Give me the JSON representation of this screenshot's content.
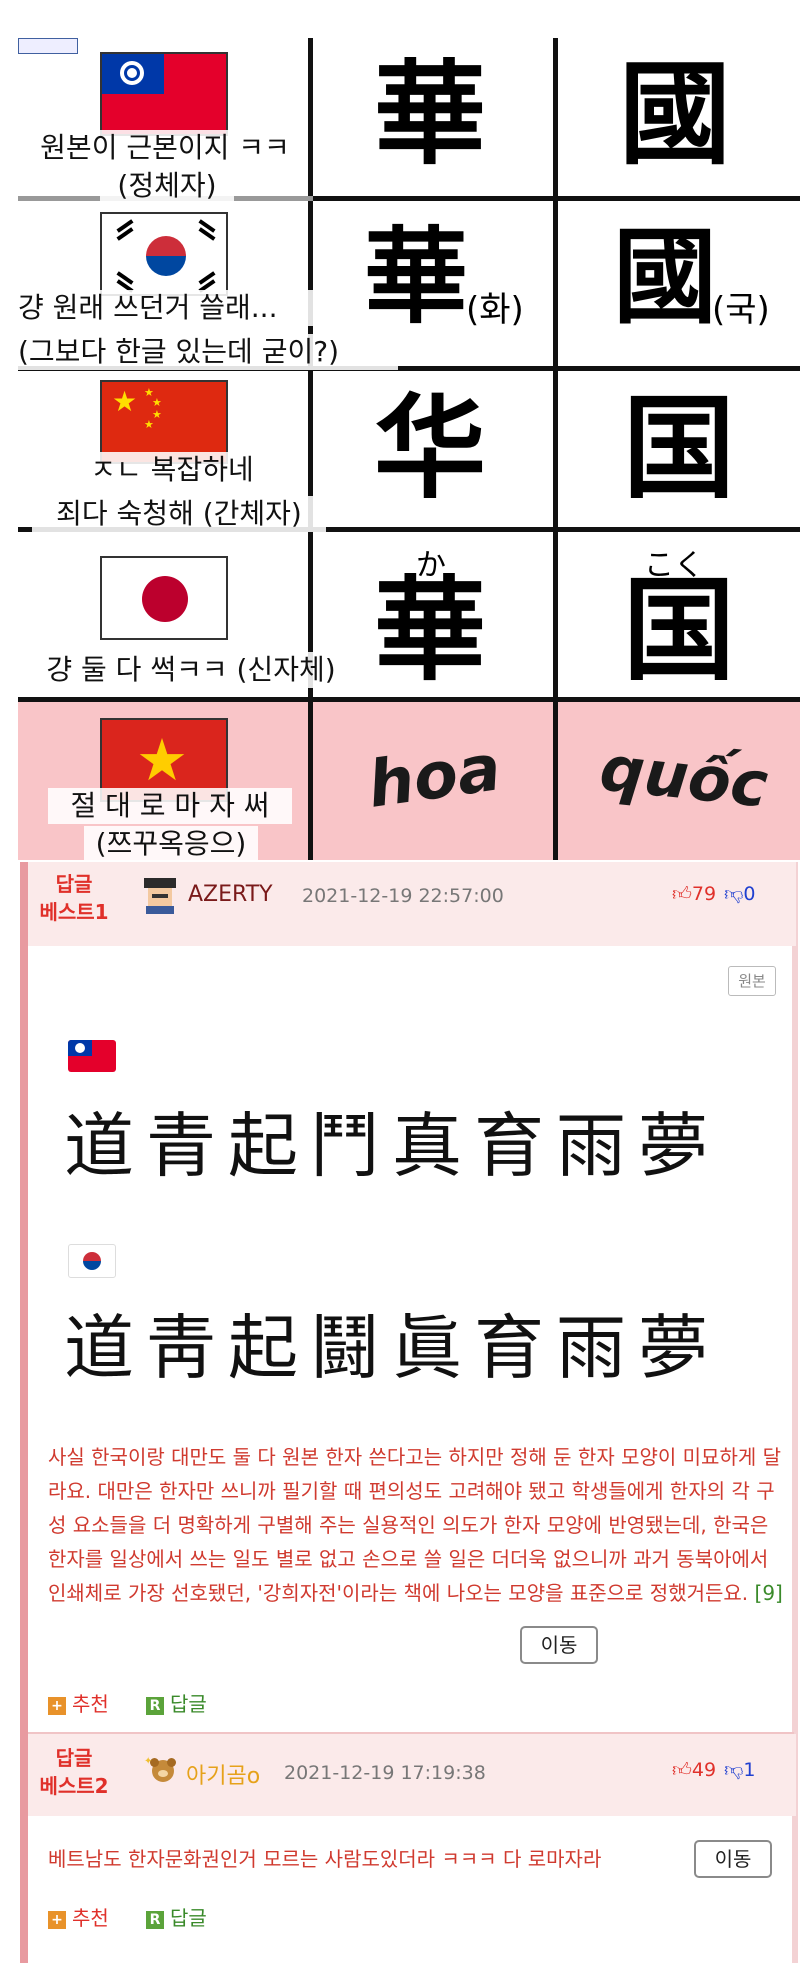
{
  "meme": {
    "rows": [
      {
        "flag": "taiwan-flag",
        "caption_lines": [
          "원본이 근본이지 ㅋㅋ",
          "(정체자)"
        ],
        "char1": "華",
        "char2": "國"
      },
      {
        "flag": "korea-flag",
        "caption_lines": [
          "걍 원래 쓰던거 쓸래...",
          "(그보다 한글 있는데 굳이?)"
        ],
        "char1": "華",
        "char1_note": "(화)",
        "char2": "國",
        "char2_note": "(국)"
      },
      {
        "flag": "china-flag",
        "caption_lines": [
          "ㅈㄴ 복잡하네",
          "죄다 숙청해 (간체자)"
        ],
        "char1": "华",
        "char2": "国"
      },
      {
        "flag": "japan-flag",
        "caption_lines": [
          "걍 둘 다 썩ㅋㅋ (신자체)"
        ],
        "char1": "華",
        "char1_ruby": "か",
        "char2": "国",
        "char2_ruby": "こく"
      },
      {
        "flag": "vietnam-flag",
        "caption_lines": [
          "절 대 로 마 자 써",
          "(쯔꾸옥응으)"
        ],
        "char1": "hoa",
        "char2": "quốc"
      }
    ],
    "colors": {
      "vietnam_row_bg": "#f9c5c8",
      "line": "#111111"
    }
  },
  "comments": [
    {
      "best_label": [
        "답글",
        "베스트1"
      ],
      "nickname": "AZERTY",
      "date": "2021-12-19 22:57:00",
      "likes": "79",
      "dislikes": "0",
      "original_badge": "원본",
      "taiwan_chars": "道青起鬥真育雨夢",
      "korea_chars": "道靑起鬪眞育雨夢",
      "text": "사실 한국이랑 대만도 둘 다 원본 한자 쓴다고는 하지만 정해 둔 한자 모양이 미묘하게 달라요. 대만은 한자만 쓰니까 필기할 때 편의성도 고려해야 됐고 학생들에게 한자의 각 구성 요소들을 더 명확하게 구별해 주는 실용적인 의도가 한자 모양에 반영됐는데, 한국은 한자를 일상에서 쓰는 일도 별로 없고 손으로 쓸 일은 더더욱 없으니까 과거 동북아에서 인쇄체로 가장 선호됐던, '강희자전'이라는 책에 나오는 모양을 표준으로 정했거든요.",
      "footnote": "[9]",
      "move_label": "이동",
      "recommend_label": "추천",
      "reply_label": "답글"
    },
    {
      "best_label": [
        "답글",
        "베스트2"
      ],
      "nickname": "아기곰o",
      "date": "2021-12-19 17:19:38",
      "likes": "49",
      "dislikes": "1",
      "text": "베트남도 한자문화권인거 모르는 사람도있더라 ㅋㅋㅋ 다 로마자라",
      "move_label": "이동",
      "recommend_label": "추천",
      "reply_label": "답글"
    }
  ],
  "colors": {
    "best_red": "#e0302a",
    "nick1": "#7a1a1a",
    "nick2": "#e6a21a",
    "like": "#e0302a",
    "dislike": "#2040d0",
    "head_bg": "#fbeaea",
    "side_bar": "#e89aa0"
  },
  "icons": {
    "like": "thumbs-up-icon",
    "dislike": "thumbs-down-icon",
    "recommend": "plus-icon",
    "reply": "reply-icon"
  }
}
